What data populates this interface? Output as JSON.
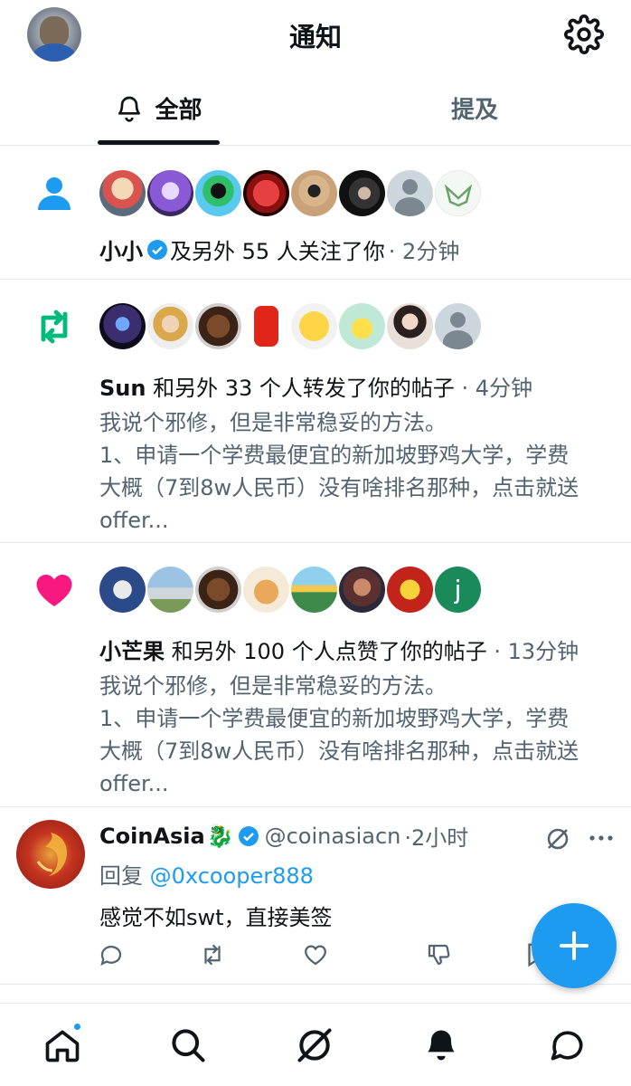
{
  "header": {
    "title": "通知"
  },
  "tabs": [
    {
      "label": "全部",
      "active": true
    },
    {
      "label": "提及",
      "active": false
    }
  ],
  "notifications": [
    {
      "type": "follow",
      "icon": "person-icon",
      "actor": "小小",
      "verified": true,
      "text": " 及另外 55 人关注了你",
      "time": "· 2分钟"
    },
    {
      "type": "repost",
      "icon": "repost-icon",
      "actor": "Sun",
      "text": " 和另外 33 个人转发了你的帖子",
      "time": "· 4分钟",
      "snippet_lines": [
        "我说个邪修，但是非常稳妥的方法。",
        "1、申请一个学费最便宜的新加坡野鸡大学，学费",
        "大概（7到8w人民币）没有啥排名那种，点击就送",
        "offer..."
      ]
    },
    {
      "type": "like",
      "icon": "heart-icon",
      "actor": "小芒果",
      "text": " 和另外 100 个人点赞了你的帖子",
      "time": "· 13分钟",
      "snippet_lines": [
        "我说个邪修，但是非常稳妥的方法。",
        "1、申请一个学费最便宜的新加坡野鸡大学，学费",
        "大概（7到8w人民币）没有啥排名那种，点击就送",
        "offer..."
      ],
      "last_avatar_letter": "j"
    }
  ],
  "tweet": {
    "name": "CoinAsia",
    "emoji": "🐉",
    "verified": true,
    "handle": "@coinasiacn",
    "time": "·2小时",
    "reply_prefix": "回复 ",
    "reply_to": "@0xcooper888",
    "text": "感觉不如swt，直接美签"
  },
  "colors": {
    "accent": "#1d9bf0",
    "follow_icon": "#1d9bf0",
    "repost_icon": "#00ba7c",
    "like_icon": "#f91880",
    "muted_text": "#536471"
  },
  "bottom_nav": [
    "home-icon",
    "search-icon",
    "grok-icon",
    "notifications-icon",
    "messages-icon"
  ]
}
